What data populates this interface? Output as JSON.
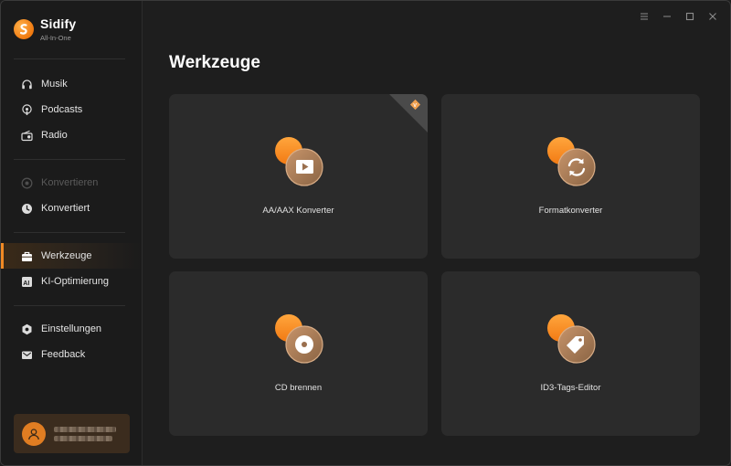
{
  "app": {
    "name": "Sidify",
    "subtitle": "All-In-One"
  },
  "sidebar": {
    "items": [
      {
        "label": "Musik",
        "icon": "headphones-icon"
      },
      {
        "label": "Podcasts",
        "icon": "podcast-icon"
      },
      {
        "label": "Radio",
        "icon": "radio-icon"
      },
      {
        "label": "Konvertieren",
        "icon": "convert-icon",
        "disabled": true
      },
      {
        "label": "Konvertiert",
        "icon": "clock-icon"
      },
      {
        "label": "Werkzeuge",
        "icon": "toolbox-icon",
        "active": true
      },
      {
        "label": "KI-Optimierung",
        "icon": "ai-icon"
      },
      {
        "label": "Einstellungen",
        "icon": "gear-icon"
      },
      {
        "label": "Feedback",
        "icon": "mail-icon"
      }
    ]
  },
  "window_controls": [
    "menu-icon",
    "minimize-icon",
    "maximize-icon",
    "close-icon"
  ],
  "main": {
    "title": "Werkzeuge",
    "tools": [
      {
        "label": "AA/AAX Konverter",
        "icon": "video-play-icon",
        "badge": "pro-badge-icon"
      },
      {
        "label": "Formatkonverter",
        "icon": "refresh-icon"
      },
      {
        "label": "CD brennen",
        "icon": "disc-icon"
      },
      {
        "label": "ID3-Tags-Editor",
        "icon": "tag-icon"
      }
    ]
  },
  "colors": {
    "accent": "#f08a24",
    "background": "#1e1e1e",
    "sidebar": "#1b1b1b",
    "card": "#2b2b2b"
  }
}
